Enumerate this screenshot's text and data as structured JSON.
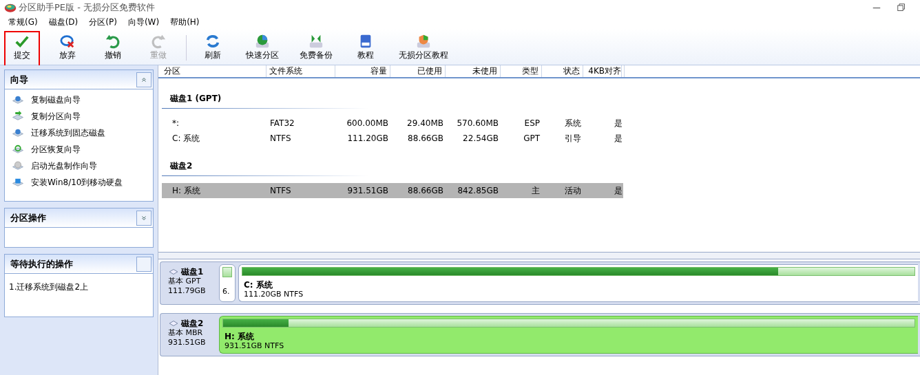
{
  "window": {
    "title": "分区助手PE版 - 无损分区免费软件"
  },
  "menu": [
    "常规(G)",
    "磁盘(D)",
    "分区(P)",
    "向导(W)",
    "帮助(H)"
  ],
  "toolbar": [
    {
      "label": "提交",
      "disabled": false,
      "highlighted": true,
      "separator_before": false
    },
    {
      "label": "放弃",
      "disabled": false,
      "highlighted": false,
      "separator_before": false
    },
    {
      "label": "撤销",
      "disabled": false,
      "highlighted": false,
      "separator_before": false
    },
    {
      "label": "重做",
      "disabled": true,
      "highlighted": false,
      "separator_before": false
    },
    {
      "label": "刷新",
      "disabled": false,
      "highlighted": false,
      "separator_before": true
    },
    {
      "label": "快速分区",
      "disabled": false,
      "highlighted": false,
      "separator_before": false
    },
    {
      "label": "免费备份",
      "disabled": false,
      "highlighted": false,
      "separator_before": false
    },
    {
      "label": "教程",
      "disabled": false,
      "highlighted": false,
      "separator_before": false
    },
    {
      "label": "无损分区教程",
      "disabled": false,
      "highlighted": false,
      "separator_before": false
    }
  ],
  "sidebar": {
    "panels": [
      {
        "title": "向导",
        "expanded": true,
        "items": [
          "复制磁盘向导",
          "复制分区向导",
          "迁移系统到固态磁盘",
          "分区恢复向导",
          "启动光盘制作向导",
          "安装Win8/10到移动硬盘"
        ]
      },
      {
        "title": "分区操作",
        "expanded": false
      },
      {
        "title": "等待执行的操作",
        "items": [
          "1.迁移系统到磁盘2上"
        ]
      }
    ]
  },
  "table": {
    "columns": [
      "分区",
      "文件系统",
      "容量",
      "已使用",
      "未使用",
      "类型",
      "状态",
      "4KB对齐"
    ],
    "groups": [
      {
        "title": "磁盘1 (GPT)",
        "rows": [
          {
            "cells": [
              "*:",
              "FAT32",
              "600.00MB",
              "29.40MB",
              "570.60MB",
              "ESP",
              "系统",
              "是"
            ],
            "selected": false
          },
          {
            "cells": [
              "C: 系统",
              "NTFS",
              "111.20GB",
              "88.66GB",
              "22.54GB",
              "GPT",
              "引导",
              "是"
            ],
            "selected": false
          }
        ]
      },
      {
        "title": "磁盘2",
        "rows": [
          {
            "cells": [
              "H: 系统",
              "NTFS",
              "931.51GB",
              "88.66GB",
              "842.85GB",
              "主",
              "活动",
              "是"
            ],
            "selected": true
          }
        ]
      }
    ]
  },
  "disk_map": [
    {
      "name": "磁盘1",
      "type": "基本 GPT",
      "size": "111.79GB",
      "partitions": [
        {
          "info": "6.",
          "small": true,
          "selected": false
        },
        {
          "label": "C: 系统",
          "info": "111.20GB NTFS",
          "level": 0.797,
          "small": false,
          "selected": false
        }
      ]
    },
    {
      "name": "磁盘2",
      "type": "基本 MBR",
      "size": "931.51GB",
      "partitions": [
        {
          "label": "H: 系统",
          "info": "931.51GB NTFS",
          "level": 0.095,
          "small": false,
          "selected": true
        }
      ]
    }
  ]
}
